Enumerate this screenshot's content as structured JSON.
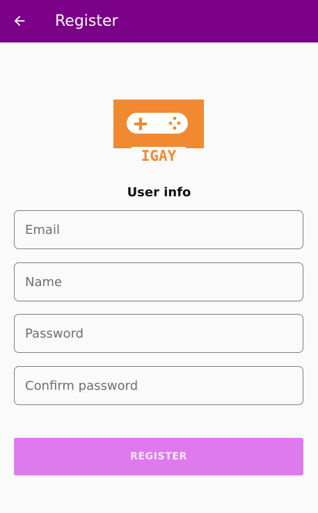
{
  "app_bar": {
    "title": "Register",
    "back_icon": "arrow-left-icon",
    "background": "#7a0088"
  },
  "logo": {
    "text": "IGAY",
    "icon": "gamepad-icon",
    "color": "#f0892f"
  },
  "form": {
    "section_title": "User info",
    "fields": {
      "email": {
        "placeholder": "Email",
        "value": ""
      },
      "name": {
        "placeholder": "Name",
        "value": ""
      },
      "password": {
        "placeholder": "Password",
        "value": ""
      },
      "confirm_password": {
        "placeholder": "Confirm password",
        "value": ""
      }
    },
    "submit_label": "REGISTER",
    "submit_color": "#df7aee"
  }
}
